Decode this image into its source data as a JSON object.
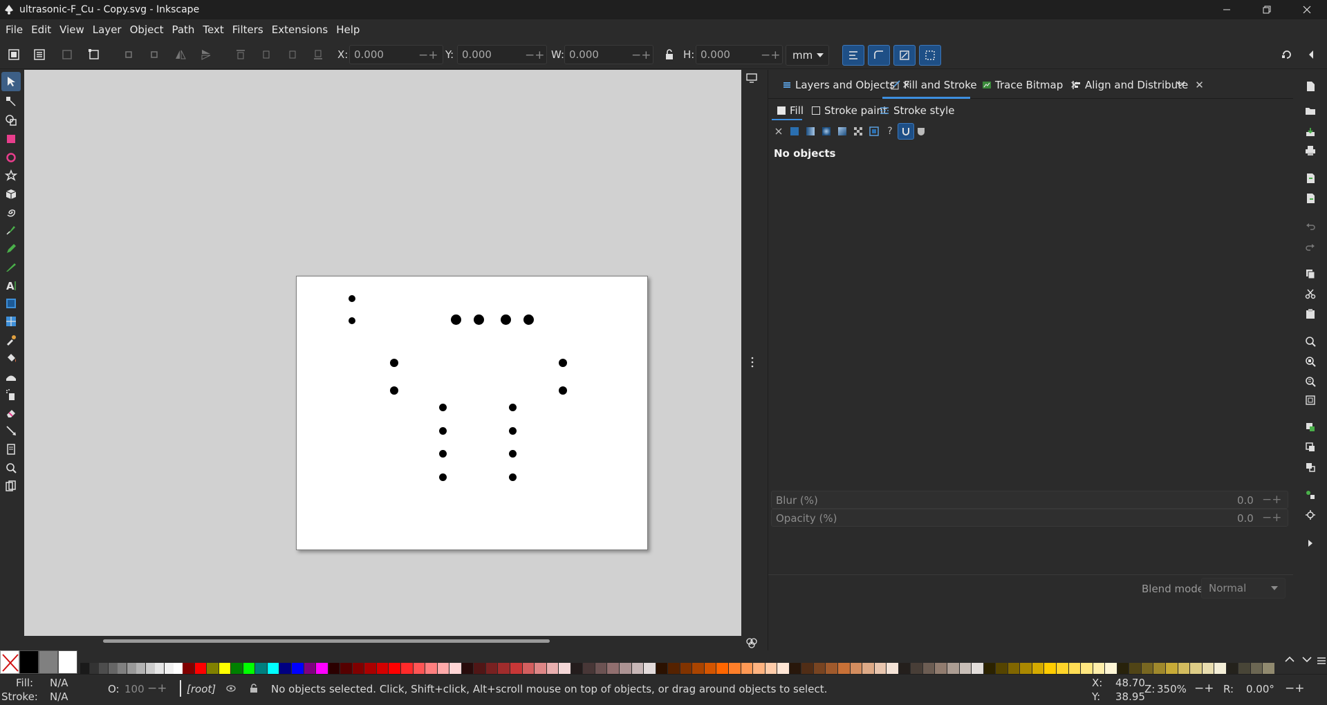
{
  "window": {
    "title": "ultrasonic-F_Cu - Copy.svg - Inkscape"
  },
  "menu": [
    "File",
    "Edit",
    "View",
    "Layer",
    "Object",
    "Path",
    "Text",
    "Filters",
    "Extensions",
    "Help"
  ],
  "toolbar": {
    "x_label": "X:",
    "x_value": "0.000",
    "y_label": "Y:",
    "y_value": "0.000",
    "w_label": "W:",
    "w_value": "0.000",
    "h_label": "H:",
    "h_value": "0.000",
    "unit": "mm"
  },
  "dock": {
    "tabs": [
      {
        "label": "Layers and Objects",
        "icon": "layers-icon"
      },
      {
        "label": "Fill and Stroke",
        "icon": "fill-stroke-icon"
      },
      {
        "label": "Trace Bitmap",
        "icon": "trace-bitmap-icon"
      },
      {
        "label": "Align and Distribute",
        "icon": "align-icon"
      }
    ],
    "subtabs": [
      "Fill",
      "Stroke paint",
      "Stroke style"
    ],
    "no_objects": "No objects",
    "blend_label": "Blend mode:",
    "blend_value": "Normal",
    "blur_label": "Blur (%)",
    "blur_value": "0.0",
    "opacity_label": "Opacity (%)",
    "opacity_value": "0.0"
  },
  "status": {
    "fill_label": "Fill:",
    "fill_value": "N/A",
    "stroke_label": "Stroke:",
    "stroke_value": "N/A",
    "opacity_label": "O:",
    "opacity_value": "100",
    "layer": "[root]",
    "message": "No objects selected. Click, Shift+click, Alt+scroll mouse on top of objects, or drag around objects to select.",
    "cursor_x_label": "X:",
    "cursor_x": "48.70",
    "cursor_y_label": "Y:",
    "cursor_y": "38.95",
    "zoom_label": "Z:",
    "zoom": "350%",
    "rotation_label": "R:",
    "rotation": "0.00°"
  },
  "palette": {
    "main": [
      "#000000",
      "#808080",
      "#ffffff"
    ],
    "grays": [
      "#1a1a1a",
      "#333333",
      "#4d4d4d",
      "#666666",
      "#808080",
      "#999999",
      "#b3b3b3",
      "#cccccc",
      "#e6e6e6",
      "#f2f2f2",
      "#ffffff"
    ],
    "colors": [
      "#800000",
      "#ff0000",
      "#808000",
      "#ffff00",
      "#008000",
      "#00ff00",
      "#008080",
      "#00ffff",
      "#000080",
      "#0000ff",
      "#800080",
      "#ff00ff",
      "#2b0000",
      "#550000",
      "#800000",
      "#aa0000",
      "#d40000",
      "#ff0000",
      "#ff2a2a",
      "#ff5555",
      "#ff8080",
      "#ffaaaa",
      "#ffd5d5",
      "#280b0b",
      "#501616",
      "#782121",
      "#a02c2c",
      "#c83737",
      "#d35f5f",
      "#de8787",
      "#e9afaf",
      "#f4d7d7",
      "#241c1c",
      "#483737",
      "#6c5353",
      "#916f6f",
      "#ac9393",
      "#c8b7b7",
      "#e3dbdb",
      "#2b1100",
      "#552200",
      "#803300",
      "#aa4400",
      "#d45500",
      "#ff6600",
      "#ff7f2a",
      "#ff9955",
      "#ffb380",
      "#ffccaa",
      "#ffe6d5",
      "#28170b",
      "#502d16",
      "#784421",
      "#a05a2c",
      "#c87137",
      "#d38d5f",
      "#deaa87",
      "#e9c6af",
      "#f4e3d7",
      "#241f1c",
      "#483e37",
      "#6c5d53",
      "#917c6f",
      "#ac9d93",
      "#c8beb7",
      "#e3dedb",
      "#2b2200",
      "#554400",
      "#806600",
      "#aa8800",
      "#d4aa00",
      "#ffcc00",
      "#ffd42a",
      "#ffdd55",
      "#ffe680",
      "#ffeeaa",
      "#fff6d5",
      "#28220b",
      "#504416",
      "#786721",
      "#a0892c",
      "#c8ab37",
      "#d3bc5f",
      "#decd87",
      "#e9ddaf",
      "#f4eed7",
      "#24221c",
      "#484537",
      "#6c6753",
      "#918a6f"
    ]
  }
}
